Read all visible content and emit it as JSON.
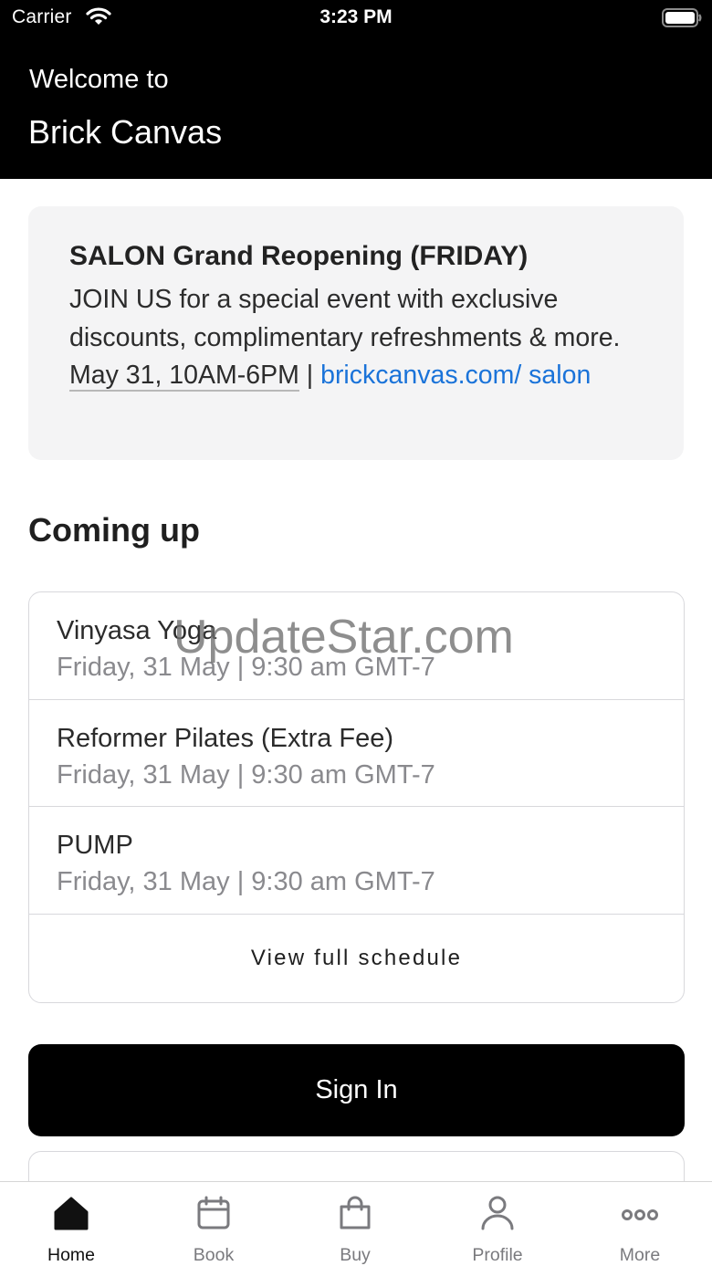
{
  "status_bar": {
    "carrier": "Carrier",
    "time": "3:23 PM"
  },
  "header": {
    "welcome": "Welcome to",
    "app_name": "Brick Canvas"
  },
  "promo": {
    "title": "SALON Grand Reopening (FRIDAY)",
    "body": "JOIN US for a special event with exclusive discounts, complimentary refreshments & more.",
    "date": "May 31, 10AM-6PM",
    "separator": "|",
    "link": "brickcanvas.com/ salon"
  },
  "coming_up": {
    "title": "Coming up",
    "classes": [
      {
        "name": "Vinyasa Yoga",
        "time": "Friday, 31 May | 9:30 am GMT-7"
      },
      {
        "name": "Reformer Pilates (Extra Fee)",
        "time": "Friday, 31 May | 9:30 am GMT-7"
      },
      {
        "name": "PUMP",
        "time": "Friday, 31 May | 9:30 am GMT-7"
      }
    ],
    "view_full_label": "View full schedule"
  },
  "watermark": "UpdateStar.com",
  "sign_in_label": "Sign In",
  "tabs": [
    {
      "label": "Home",
      "icon": "home-icon",
      "active": true
    },
    {
      "label": "Book",
      "icon": "calendar-icon",
      "active": false
    },
    {
      "label": "Buy",
      "icon": "shopping-bag-icon",
      "active": false
    },
    {
      "label": "Profile",
      "icon": "person-icon",
      "active": false
    },
    {
      "label": "More",
      "icon": "more-dots-icon",
      "active": false
    }
  ],
  "colors": {
    "header_bg": "#000000",
    "link": "#1a73d9",
    "card_bg": "#f4f4f5",
    "button_bg": "#000000"
  }
}
